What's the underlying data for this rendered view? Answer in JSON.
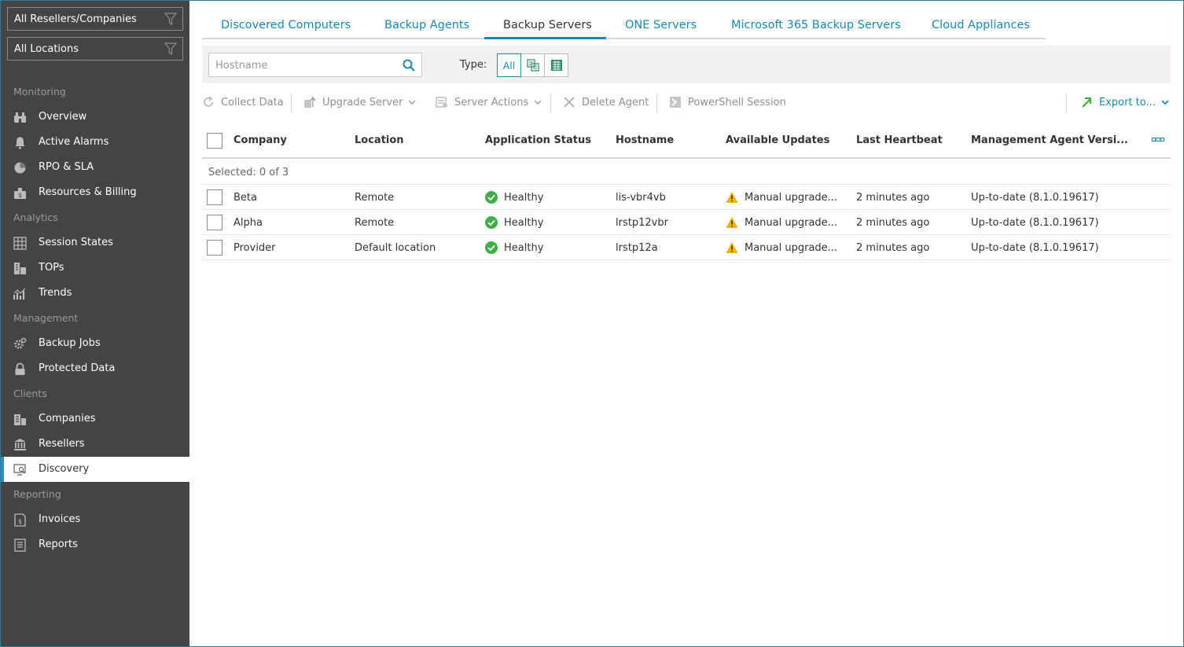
{
  "filters": {
    "resellers": "All Resellers/Companies",
    "locations": "All Locations"
  },
  "sidebar": {
    "sections": {
      "monitoring": "Monitoring",
      "analytics": "Analytics",
      "management": "Management",
      "clients": "Clients",
      "reporting": "Reporting"
    },
    "items": [
      {
        "label": "Overview",
        "icon": "binoculars-icon"
      },
      {
        "label": "Active Alarms",
        "icon": "bell-icon"
      },
      {
        "label": "RPO & SLA",
        "icon": "pie-icon"
      },
      {
        "label": "Resources & Billing",
        "icon": "money-icon"
      },
      {
        "label": "Session States",
        "icon": "grid-icon"
      },
      {
        "label": "TOPs",
        "icon": "tops-icon"
      },
      {
        "label": "Trends",
        "icon": "trends-icon"
      },
      {
        "label": "Backup Jobs",
        "icon": "gear-icon"
      },
      {
        "label": "Protected Data",
        "icon": "lock-icon"
      },
      {
        "label": "Companies",
        "icon": "building-icon"
      },
      {
        "label": "Resellers",
        "icon": "bank-icon"
      },
      {
        "label": "Discovery",
        "icon": "discovery-icon"
      },
      {
        "label": "Invoices",
        "icon": "invoice-icon"
      },
      {
        "label": "Reports",
        "icon": "report-icon"
      }
    ]
  },
  "tabs": [
    "Discovered Computers",
    "Backup Agents",
    "Backup Servers",
    "ONE Servers",
    "Microsoft 365 Backup Servers",
    "Cloud Appliances"
  ],
  "active_tab": "Backup Servers",
  "search": {
    "placeholder": "Hostname"
  },
  "type_filter": {
    "label": "Type:",
    "all": "All"
  },
  "toolbar": {
    "collect_data": "Collect Data",
    "upgrade_server": "Upgrade Server",
    "server_actions": "Server Actions",
    "delete_agent": "Delete Agent",
    "powershell_session": "PowerShell Session",
    "export": "Export to..."
  },
  "table": {
    "columns": [
      "Company",
      "Location",
      "Application Status",
      "Hostname",
      "Available Updates",
      "Last Heartbeat",
      "Management Agent Versi..."
    ],
    "selected_text": "Selected: 0 of 3",
    "rows": [
      {
        "company": "Beta",
        "location": "Remote",
        "status": "Healthy",
        "hostname": "lis-vbr4vb",
        "updates": "Manual upgrade...",
        "heartbeat": "2 minutes ago",
        "agent_version": "Up-to-date (8.1.0.19617)"
      },
      {
        "company": "Alpha",
        "location": "Remote",
        "status": "Healthy",
        "hostname": "lrstp12vbr",
        "updates": "Manual upgrade...",
        "heartbeat": "2 minutes ago",
        "agent_version": "Up-to-date (8.1.0.19617)"
      },
      {
        "company": "Provider",
        "location": "Default location",
        "status": "Healthy",
        "hostname": "lrstp12a",
        "updates": "Manual upgrade...",
        "heartbeat": "2 minutes ago",
        "agent_version": "Up-to-date (8.1.0.19617)"
      }
    ]
  },
  "colors": {
    "accent": "#1a88b0",
    "sidebar_bg": "#444444",
    "healthy": "#3fae49",
    "warning": "#f0b400",
    "export_icon": "#3fae49"
  }
}
